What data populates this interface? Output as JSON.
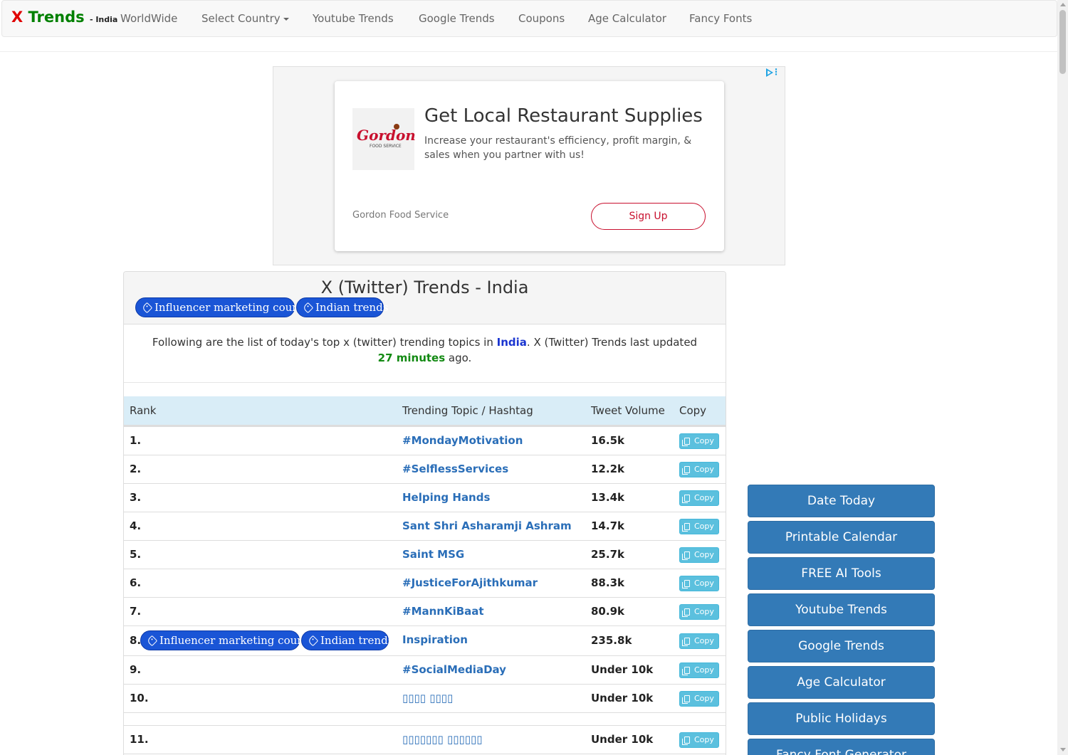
{
  "nav": {
    "brand_x": "X",
    "brand_trends": "Trends",
    "brand_country": "- India",
    "items": [
      "WorldWide",
      "Select Country",
      "Youtube Trends",
      "Google Trends",
      "Coupons",
      "Age Calculator",
      "Fancy Fonts"
    ]
  },
  "ad": {
    "logo_text": "Gordon",
    "logo_sub": "FOOD SERVICE",
    "headline": "Get Local Restaurant Supplies",
    "description": "Increase your restaurant's efficiency, profit margin, & sales when you partner with us!",
    "advertiser": "Gordon Food Service",
    "cta": "Sign Up"
  },
  "page": {
    "title": "X (Twitter) Trends - India",
    "tags": [
      "Influencer marketing courses",
      "Indian trends"
    ],
    "intro_before": "Following are the list of today's top x (twitter) trending topics in ",
    "intro_country": "India",
    "intro_middle": ". X (Twitter) Trends last updated ",
    "intro_minutes": "27 minutes",
    "intro_after": " ago."
  },
  "table": {
    "headers": [
      "Rank",
      "Trending Topic / Hashtag",
      "Tweet Volume",
      "Copy"
    ],
    "copy_label": "Copy",
    "rows": [
      {
        "rank": "1.",
        "topic": "#MondayMotivation",
        "volume": "16.5k"
      },
      {
        "rank": "2.",
        "topic": "#SelflessServices",
        "volume": "12.2k"
      },
      {
        "rank": "3.",
        "topic": "Helping Hands",
        "volume": "13.4k"
      },
      {
        "rank": "4.",
        "topic": "Sant Shri Asharamji Ashram",
        "volume": "14.7k"
      },
      {
        "rank": "5.",
        "topic": "Saint MSG",
        "volume": "25.7k"
      },
      {
        "rank": "6.",
        "topic": "#JusticeForAjithkumar",
        "volume": "88.3k"
      },
      {
        "rank": "7.",
        "topic": "#MannKiBaat",
        "volume": "80.9k"
      },
      {
        "rank": "8.",
        "topic": "Inspiration",
        "volume": "235.8k"
      },
      {
        "rank": "9.",
        "topic": "#SocialMediaDay",
        "volume": "Under 10k"
      },
      {
        "rank": "10.",
        "topic": "▯▯▯▯ ▯▯▯▯",
        "volume": "Under 10k"
      },
      {
        "rank": "11.",
        "topic": "▯▯▯▯▯▯▯ ▯▯▯▯▯▯",
        "volume": "Under 10k"
      }
    ]
  },
  "sidebar": {
    "buttons": [
      "Date Today",
      "Printable Calendar",
      "FREE AI Tools",
      "Youtube Trends",
      "Google Trends",
      "Age Calculator",
      "Public Holidays",
      "Fancy Font Generator"
    ]
  },
  "colors": {
    "brand_red": "#e00000",
    "brand_green": "#008000",
    "tag_blue": "#1a55d6",
    "table_header_bg": "#d9edf7",
    "topic_link": "#2a6eb8",
    "copy_button": "#5bc0de",
    "sidebar_button": "#337ab7",
    "ad_accent": "#c8102e"
  }
}
